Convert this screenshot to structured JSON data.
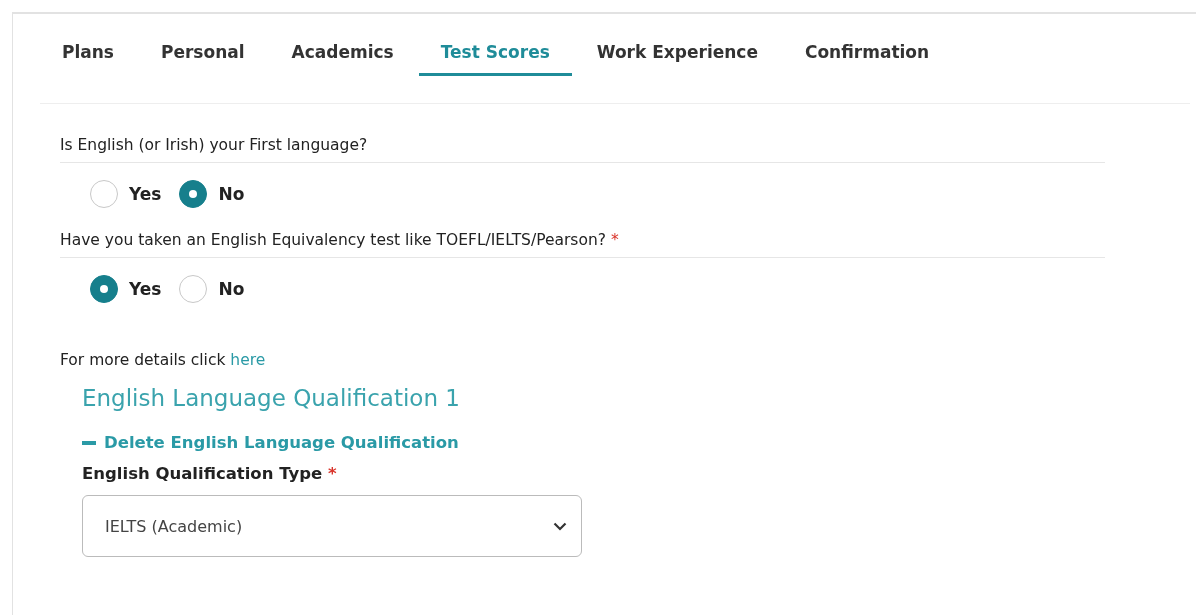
{
  "tabs": [
    {
      "label": "Plans",
      "selected": false
    },
    {
      "label": "Personal",
      "selected": false
    },
    {
      "label": "Academics",
      "selected": false
    },
    {
      "label": "Test Scores",
      "selected": true
    },
    {
      "label": "Work Experience",
      "selected": false
    },
    {
      "label": "Confirmation",
      "selected": false
    }
  ],
  "questions": [
    {
      "label": "Is English (or Irish) your First language?",
      "options": [
        {
          "label": "Yes",
          "selected": false
        },
        {
          "label": "No",
          "selected": true
        }
      ]
    },
    {
      "label": "Have you taken an English Equivalency test like TOEFL/IELTS/Pearson?",
      "required_mark": "*",
      "options": [
        {
          "label": "Yes",
          "selected": true
        },
        {
          "label": "No",
          "selected": false
        }
      ]
    }
  ],
  "details": {
    "text": "For more details click",
    "link": "here"
  },
  "qualification": {
    "title": "English Language Qualification 1",
    "delete_link": "Delete English Language Qualification",
    "type_field": {
      "label": "English Qualification Type",
      "required_mark": "*",
      "value": "IELTS (Academic)"
    }
  }
}
